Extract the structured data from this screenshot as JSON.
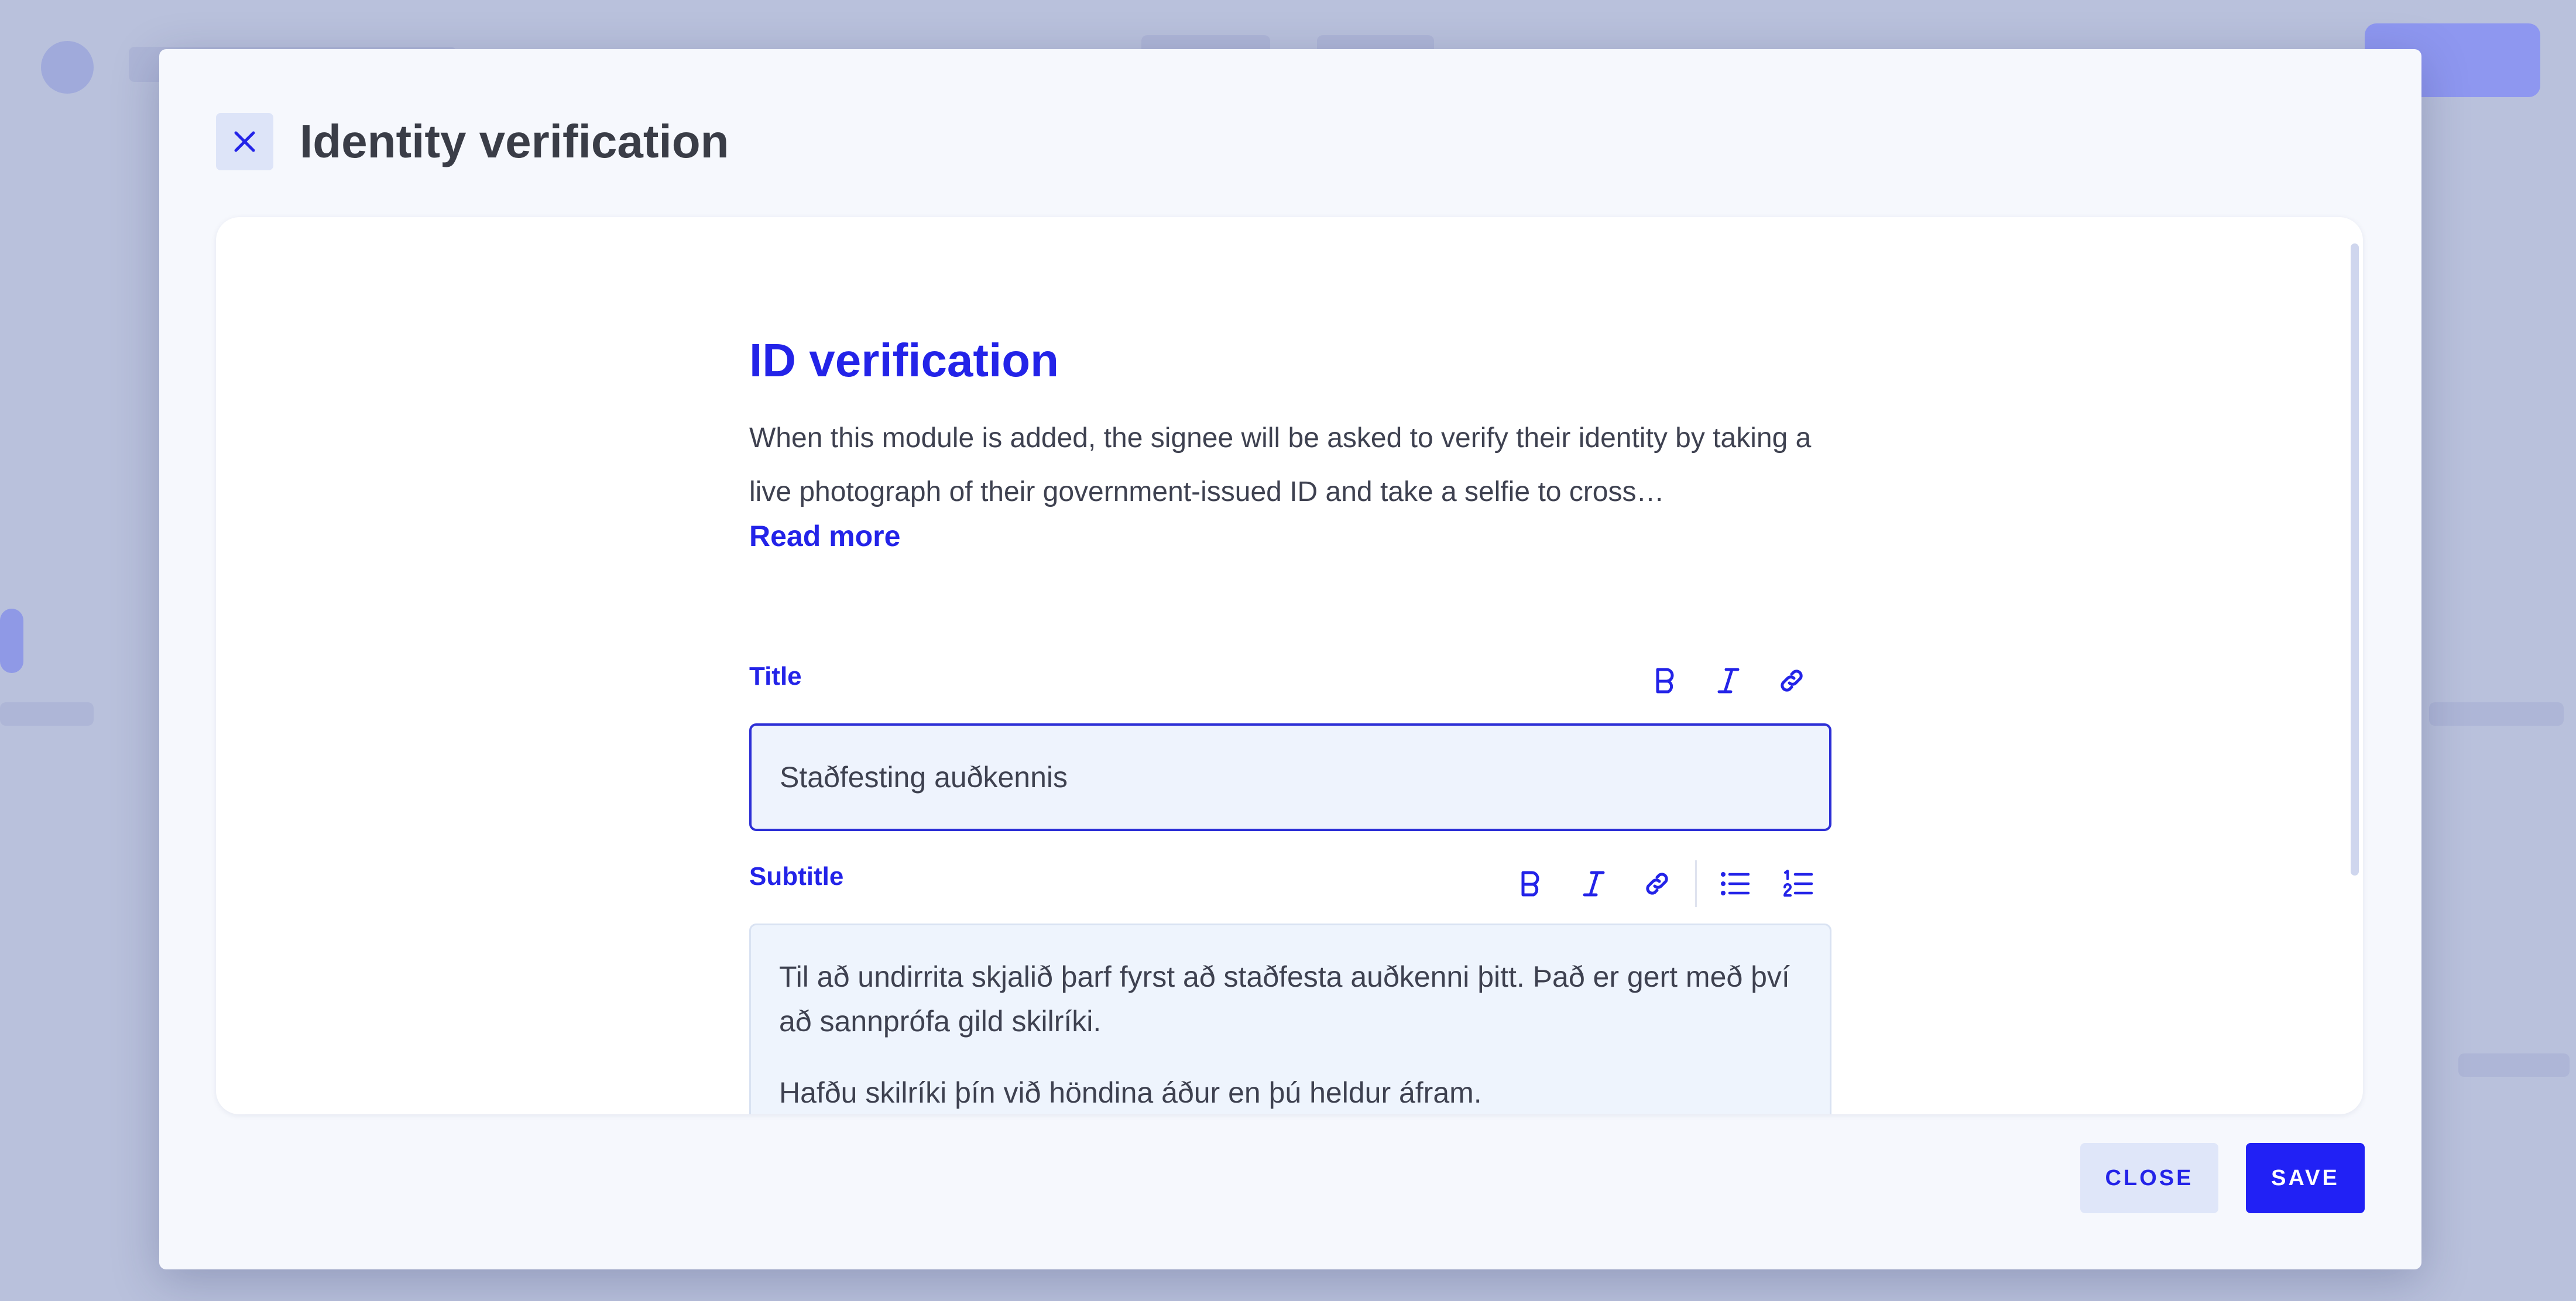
{
  "modal": {
    "title": "Identity verification"
  },
  "module": {
    "heading": "ID verification",
    "description": "When this module is added, the signee will be asked to verify their identity by taking a live photograph of their government-issued ID and take a selfie to cross…",
    "read_more": "Read more"
  },
  "fields": {
    "title": {
      "label": "Title",
      "value": "Staðfesting auðkennis"
    },
    "subtitle": {
      "label": "Subtitle",
      "paragraphs": [
        "Til að undirrita skjalið þarf fyrst að staðfesta auðkenni þitt. Það er gert með því að sannprófa gild skilríki.",
        "Hafðu skilríki þín við höndina áður en þú heldur áfram."
      ]
    }
  },
  "toolbar_icons": {
    "bold": "bold-icon",
    "italic": "italic-icon",
    "link": "link-icon",
    "bulleted_list": "bulleted-list-icon",
    "numbered_list": "numbered-list-icon"
  },
  "actions": {
    "close_label": "CLOSE",
    "save_label": "SAVE"
  },
  "colors": {
    "accent": "#2323e8",
    "primary_button": "#2121f5",
    "secondary_button": "#dfe6f9",
    "text": "#3e4150",
    "overlay": "#b9c1dc"
  }
}
